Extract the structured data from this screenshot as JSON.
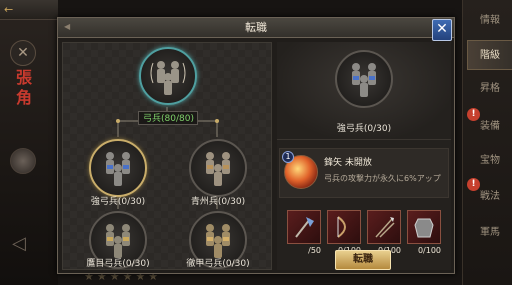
{
  "background": {
    "back_label": "←",
    "hero_name": "張角",
    "stars": "★★★★★★"
  },
  "side_tabs": [
    {
      "label": "情報",
      "active": false,
      "alert": false
    },
    {
      "label": "階級",
      "active": true,
      "alert": false
    },
    {
      "label": "昇格",
      "active": false,
      "alert": false
    },
    {
      "label": "装備",
      "active": false,
      "alert": true
    },
    {
      "label": "宝物",
      "active": false,
      "alert": false
    },
    {
      "label": "戦法",
      "active": false,
      "alert": true
    },
    {
      "label": "軍馬",
      "active": false,
      "alert": false
    }
  ],
  "dialog": {
    "title": "転職",
    "close_icon": "✕"
  },
  "tree": {
    "root": {
      "label": "弓兵(80/80)"
    },
    "mid_left": {
      "label": "強弓兵(0/30)"
    },
    "mid_right": {
      "label": "青州兵(0/30)"
    },
    "bottom_left": {
      "label": "鷹目弓兵(0/30)"
    },
    "bottom_right": {
      "label": "徹甲弓兵(0/30)"
    }
  },
  "detail": {
    "unit_name": "強弓兵(0/30)",
    "skill": {
      "level": "1",
      "name": "鋒矢  未開放",
      "description": "弓兵の攻撃力が永久に6%アップ"
    },
    "materials": [
      {
        "icon": "axe-icon",
        "count": "/50"
      },
      {
        "icon": "bow-icon",
        "count": "0/100"
      },
      {
        "icon": "arrows-icon",
        "count": "0/100"
      },
      {
        "icon": "armor-icon",
        "count": "0/100"
      }
    ],
    "button_label": "転職"
  }
}
